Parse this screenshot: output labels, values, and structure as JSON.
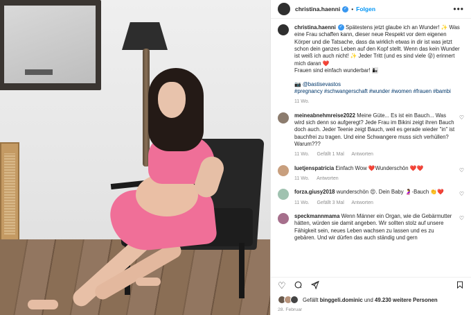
{
  "post": {
    "username": "christina.haenni",
    "follow_label": "Folgen",
    "more_label": "•••"
  },
  "caption": {
    "username": "christina.haenni",
    "line1": "Spätestens jetzt glaube ich an Wunder! ✨ Was eine Frau schaffen kann, dieser neue Respekt vor dem eigenen Körper und die Tatsache, dass da wirklich etwas in dir ist was jetzt schon dein ganzes Leben auf den Kopf stellt. Wenn das kein Wunder ist weiß ich auch nicht! ✨ Jeder Tritt (und es sind viele 😜) erinnert mich daran ❤️",
    "line2": "Frauen sind einfach wunderbar! 👩‍👧",
    "credit": "📷 @bastisevastos",
    "tags": "#pregnancy #schwangerschaft #wunder #women #frauen #bambi",
    "time": "11 Wo."
  },
  "comments": [
    {
      "username": "meineabnehmreise2022",
      "text": "Meine Güte... Es ist ein Bauch... Was wird sich denn so aufgeregt? Jede Frau im Bikini zeigt ihren Bauch doch auch. Jeder Teenie zeigt Bauch, weil es gerade wieder \"in\" ist bauchfrei zu tragen. Und eine Schwangere muss sich verhüllen? Warum???",
      "time": "11 Wo.",
      "likes": "Gefällt 1 Mal",
      "reply": "Antworten"
    },
    {
      "username": "luetjenspatricia",
      "text": "Einfach Wow ❤️Wunderschön ❤️❤️",
      "time": "11 Wo.",
      "likes": "",
      "reply": "Antworten"
    },
    {
      "username": "forza.giusy2018",
      "text": "wunderschön 😍. Dein Baby 🤰-Bauch 👏❤️",
      "time": "11 Wo.",
      "likes": "Gefällt 3 Mal",
      "reply": "Antworten"
    },
    {
      "username": "speckmannmama",
      "text": "Wenn Männer ein Organ, wie die Gebärmutter hätten, würden sie damit angeben. Wir sollten stolz auf unsere Fähigkeit sein, neues Leben wachsen zu lassen und es zu gebären. Und wir dürfen das auch ständig und gern",
      "time": "",
      "likes": "",
      "reply": ""
    }
  ],
  "likes_line": {
    "prefix": "Gefällt",
    "user": "binggeli.dominic",
    "middle": "und",
    "count": "49.230 weitere Personen"
  },
  "date": "28. Februar",
  "icons": [
    "heart-icon",
    "comment-icon",
    "share-icon",
    "bookmark-icon"
  ]
}
